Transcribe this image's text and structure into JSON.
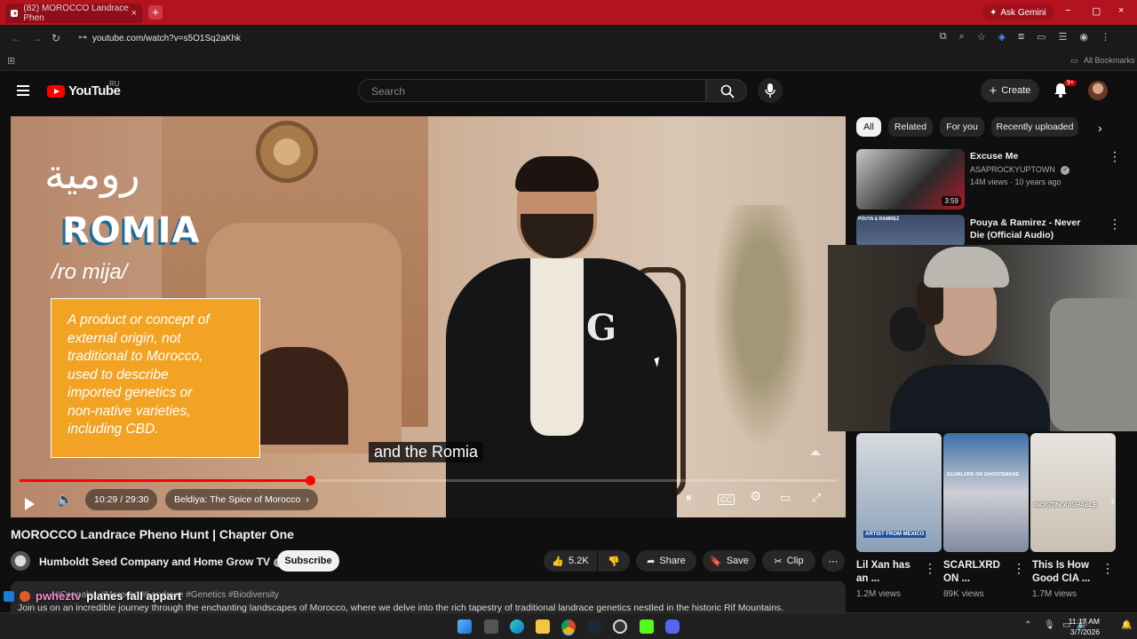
{
  "browser": {
    "tab_title": "(82) MOROCCO Landrace Phen",
    "tab_close": "×",
    "new_tab": "+",
    "ask_gemini": "Ask Gemini",
    "url": "youtube.com/watch?v=s5O1Sq2aKhk",
    "all_bookmarks": "All Bookmarks",
    "window_controls": [
      "−",
      "▢",
      "×"
    ]
  },
  "youtube": {
    "logo_text": "YouTube",
    "region": "RU",
    "search_placeholder": "Search",
    "create_label": "Create",
    "notif_count": "9+"
  },
  "player": {
    "overlay": {
      "arabic": "رومية",
      "word": "ROMIA",
      "pronunciation": "/ro mija/",
      "definition_lines": [
        "A product or concept of",
        "external origin, not",
        "traditional to Morocco,",
        "used to describe",
        "imported genetics or",
        "non-native varieties,",
        "including CBD."
      ]
    },
    "caption": "and the Romia",
    "time": "10:29 / 29:30",
    "chapter": "Beldiya: The Spice of Morocco",
    "progress": 0.355,
    "icons": [
      "pause-icon",
      "cc-icon",
      "settings-icon",
      "theater-icon",
      "fullscreen-icon"
    ]
  },
  "video": {
    "title": "MOROCCO Landrace Pheno Hunt | Chapter One",
    "channel": "Humboldt Seed Company and Home Grow TV",
    "subscribe_label": "Subscribe",
    "likes": "5.2K",
    "share_label": "Share",
    "save_label": "Save",
    "clip_label": "Clip",
    "hashtags": "#Cannabis #Morocco #Landrace #Genetics #Biodiversity",
    "description": "Join us on an incredible journey through the enchanting landscapes of Morocco, where we delve into the rich tapestry of traditional landrace genetics nestled in the historic Rif Mountains."
  },
  "chat_overlay": {
    "user": "pwheztv",
    "message": "planes fall appart"
  },
  "sidebar": {
    "chips": [
      "All",
      "Related",
      "For you",
      "Recently uploaded"
    ],
    "recs": [
      {
        "title": "Excuse Me",
        "channel": "ASAPROCKYUPTOWN",
        "meta": "14M views · 10 years ago",
        "duration": "3:59"
      },
      {
        "title": "Pouya & Ramirez - Never Die (Official Audio)",
        "thumb_label": "POUYA & RAMIREZ"
      }
    ],
    "shorts": [
      {
        "title": "Lil Xan has an ...",
        "views": "1.2M views",
        "badge": "ARTIST FROM MEXICO"
      },
      {
        "title": "SCARLXRD ON ...",
        "views": "89K views",
        "badge": "SCARLXRD ON GHOSTEMANE"
      },
      {
        "title": "This Is How Good CIA ...",
        "views": "1.7M views",
        "badge": "INDISTINGUISHABLE"
      }
    ]
  },
  "taskbar": {
    "time": "11:17 AM",
    "date": "3/7/2026"
  }
}
